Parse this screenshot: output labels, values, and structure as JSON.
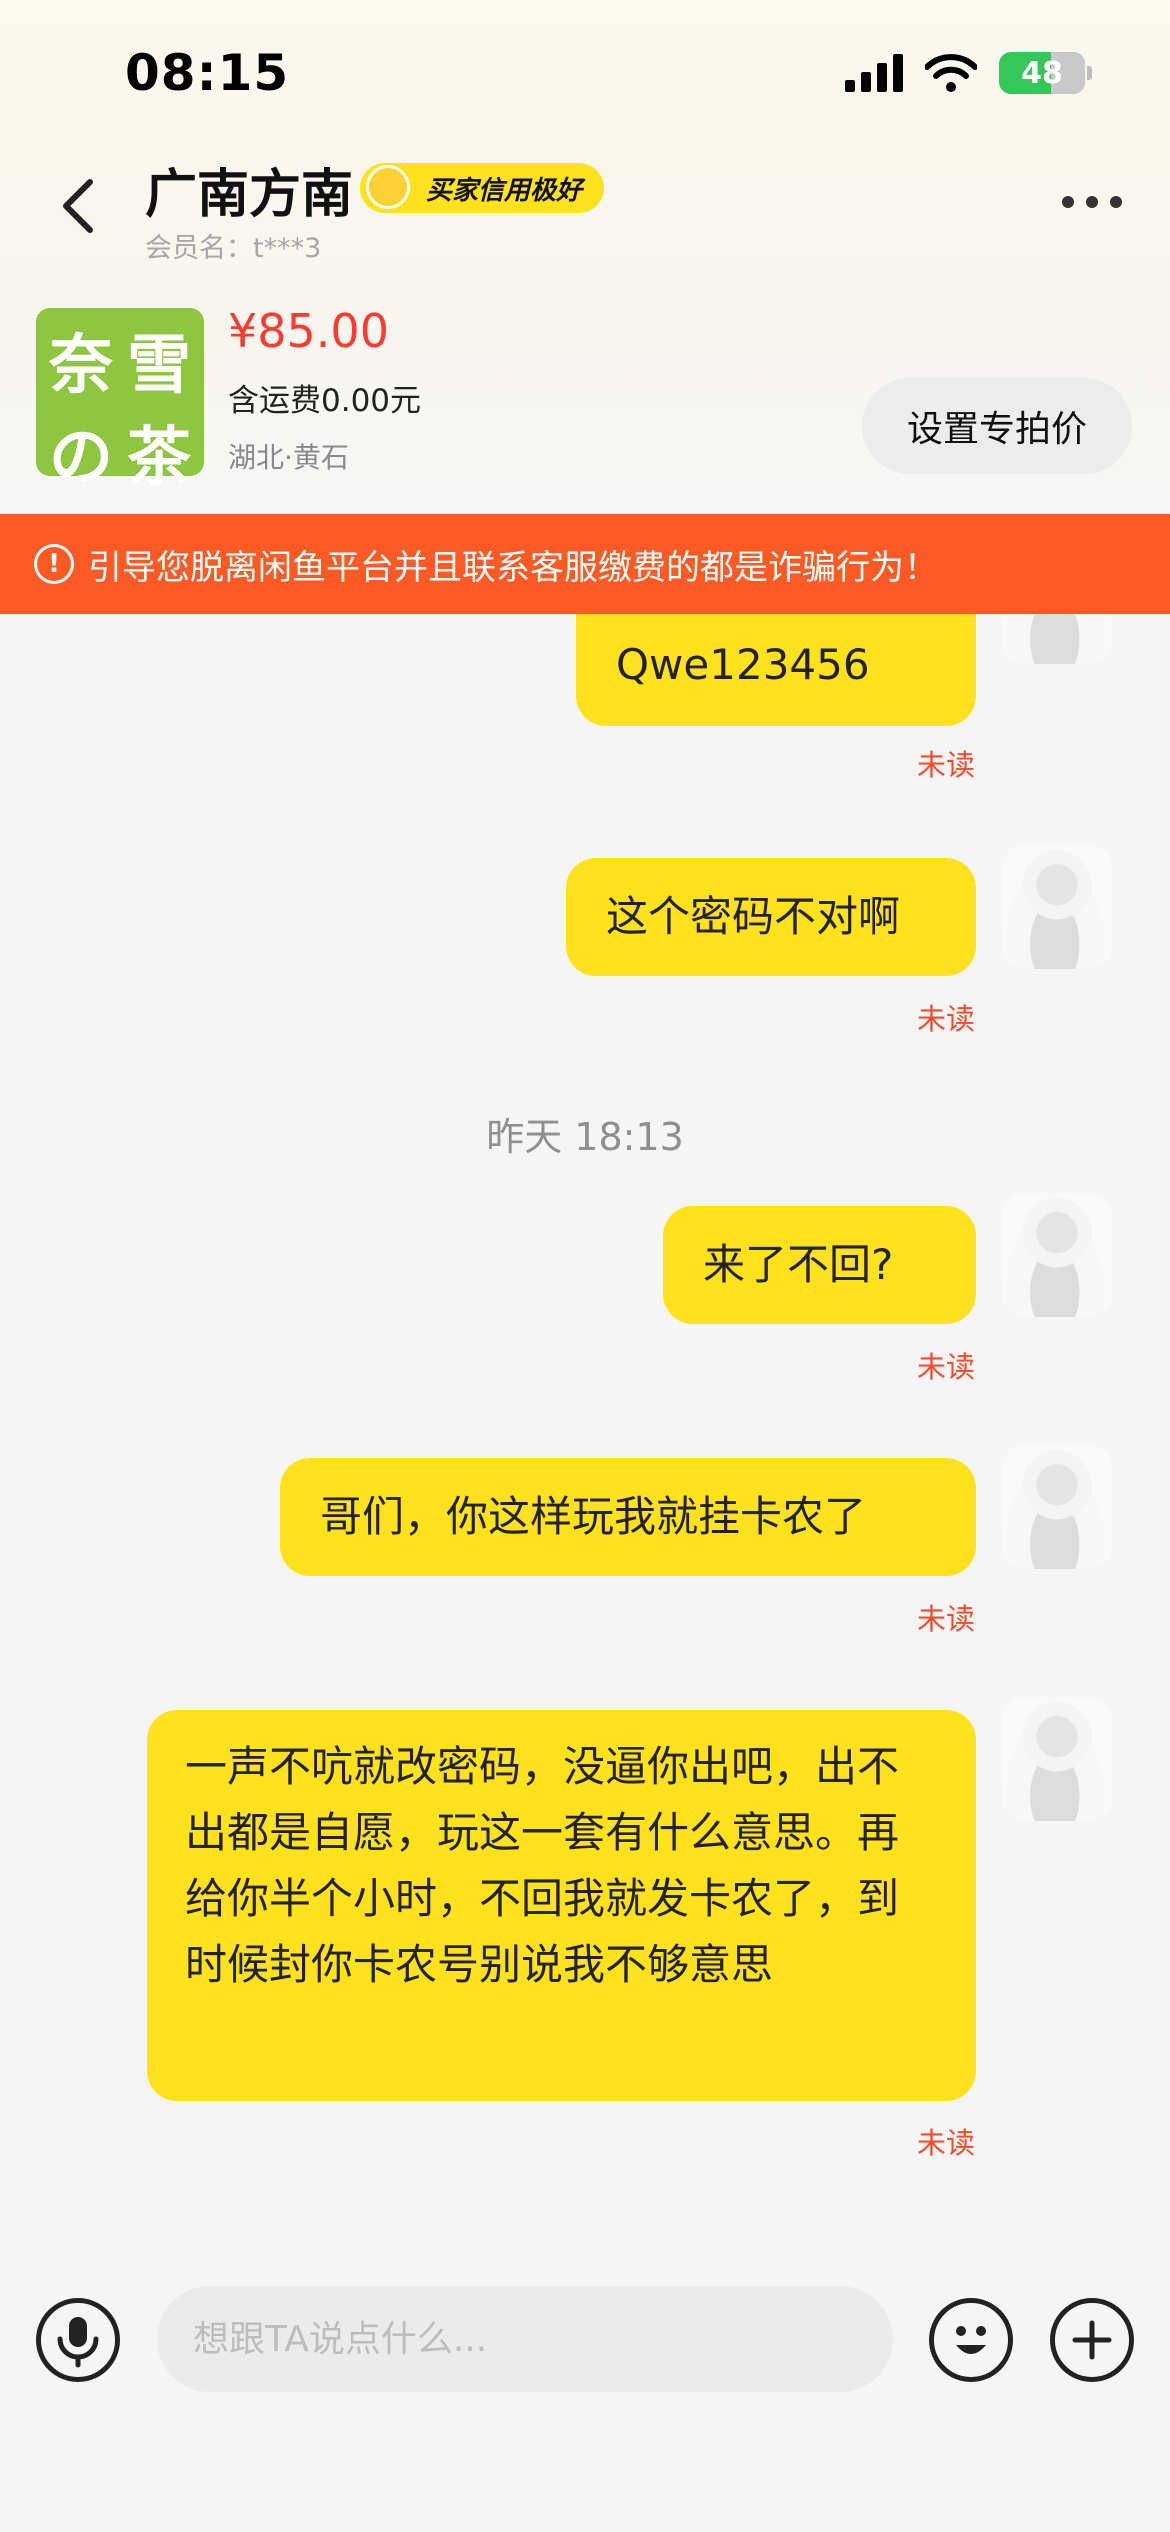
{
  "status_bar": {
    "time": "08:15",
    "battery": "48"
  },
  "header": {
    "title": "广南方南",
    "badge": "买家信用极好",
    "member": "会员名：t***3"
  },
  "product": {
    "image_text": [
      "奈",
      "雪",
      "の",
      "茶"
    ],
    "price": "¥85.00",
    "shipping": "含运费0.00元",
    "location": "湖北·黄石",
    "set_price_button": "设置专拍价"
  },
  "warning": "引导您脱离闲鱼平台并且联系客服缴费的都是诈骗行为！",
  "messages": [
    {
      "text": "Qwe123456",
      "status": "未读"
    },
    {
      "text": "这个密码不对啊",
      "status": "未读"
    },
    {
      "text": "来了不回?",
      "status": "未读"
    },
    {
      "text": "哥们，你这样玩我就挂卡农了",
      "status": "未读"
    },
    {
      "text": "一声不吭就改密码，没逼你出吧，出不出都是自愿，玩这一套有什么意思。再给你半个小时，不回我就发卡农了，到时候封你卡农号别说我不够意思",
      "status": "未读"
    }
  ],
  "time_label": "昨天 18:13",
  "input": {
    "placeholder": "想跟TA说点什么..."
  },
  "colors": {
    "bubble": "#ffe21c",
    "warning": "#ff5a24",
    "price": "#ff3b30",
    "unread": "#ff4a2a"
  }
}
